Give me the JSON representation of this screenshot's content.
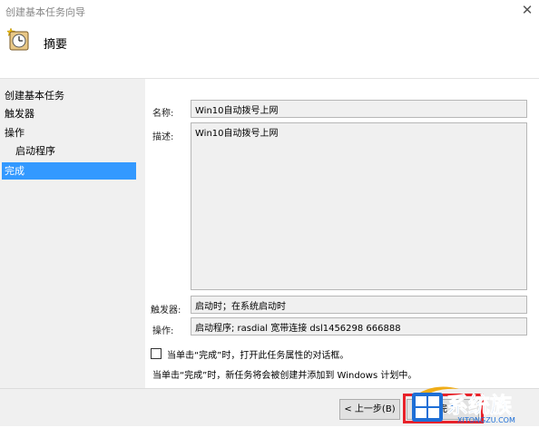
{
  "window": {
    "title": "创建基本任务向导",
    "close_glyph": "✕"
  },
  "header": {
    "title": "摘要",
    "icon": "task-clock-icon"
  },
  "nav": {
    "items": [
      {
        "label": "创建基本任务"
      },
      {
        "label": "触发器"
      },
      {
        "label": "操作"
      },
      {
        "label": "启动程序"
      },
      {
        "label": "完成"
      }
    ]
  },
  "form": {
    "name_label": "名称:",
    "name_value": "Win10自动拨号上网",
    "desc_label": "描述:",
    "desc_value": "Win10自动拨号上网",
    "trigger_label": "触发器:",
    "trigger_value": "启动时；在系统启动时",
    "action_label": "操作:",
    "action_value": "启动程序; rasdial 宽带连接 dsl1456298 666888"
  },
  "checkbox_label": "当单击“完成”时，打开此任务属性的对话框。",
  "note": "当单击“完成”时，新任务将会被创建并添加到 Windows 计划中。",
  "buttons": {
    "back": "< 上一步(B)",
    "finish": "完"
  },
  "watermark": {
    "brand": "系统族",
    "url": "XITONGZU.COM"
  },
  "colors": {
    "selection": "#3399ff",
    "highlight": "#e8222a",
    "brand": "#1e6fd6"
  }
}
